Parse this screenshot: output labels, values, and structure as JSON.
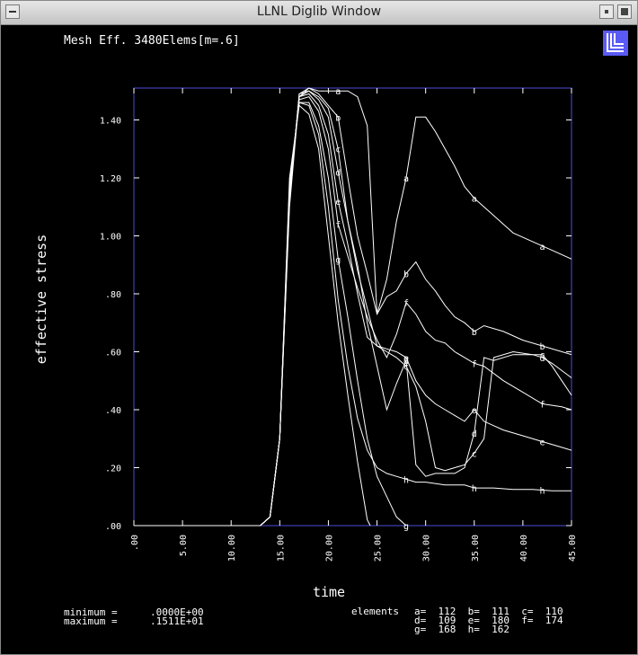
{
  "window": {
    "title": "LLNL Diglib Window"
  },
  "colors": {
    "background": "#000000",
    "frame": "#4b4bd6",
    "curve": "#ffffff",
    "logo": "#5a5af5"
  },
  "icons": {
    "logo": "llnl-logo-icon",
    "menu": "window-menu-icon",
    "minimize": "minimize-icon",
    "maximize": "maximize-icon"
  },
  "footer": {
    "minimum_label": "minimum =",
    "minimum_value": ".0000E+00",
    "maximum_label": "maximum =",
    "maximum_value": ".1511E+01",
    "elements_title": "elements",
    "elements_rows": [
      "a=  112  b=  111  c=  110",
      "d=  109  e=  180  f=  174",
      "g=  168  h=  162"
    ]
  },
  "chart_data": {
    "type": "line",
    "title": "Mesh Eff. 3480Elems[m=.6]",
    "xlabel": "time",
    "ylabel": "effective stress",
    "xlim": [
      0,
      45
    ],
    "ylim": [
      0,
      1.51
    ],
    "x_ticks": [
      0,
      5,
      10,
      15,
      20,
      25,
      30,
      35,
      40,
      45
    ],
    "x_tick_labels": [
      ".00",
      "5.00",
      "10.00",
      "15.00",
      "20.00",
      "25.00",
      "30.00",
      "35.00",
      "40.00",
      "45.00"
    ],
    "y_ticks": [
      0,
      0.2,
      0.4,
      0.6,
      0.8,
      1.0,
      1.2,
      1.4
    ],
    "y_tick_labels": [
      ".00",
      ".20",
      ".40",
      ".60",
      ".80",
      "1.00",
      "1.20",
      "1.40"
    ],
    "grid": false,
    "series": [
      {
        "name": "a",
        "marker_x": [
          21,
          28,
          35,
          42
        ],
        "x": [
          0,
          13,
          14,
          15,
          16,
          17,
          18,
          19,
          20,
          21,
          22,
          23,
          24,
          25,
          26,
          27,
          28,
          29,
          30,
          31,
          32,
          33,
          34,
          35,
          37,
          39,
          41,
          43,
          45
        ],
        "y": [
          0,
          0,
          0.03,
          0.3,
          1.1,
          1.48,
          1.51,
          1.5,
          1.5,
          1.5,
          1.5,
          1.48,
          1.38,
          0.73,
          0.85,
          1.05,
          1.2,
          1.41,
          1.41,
          1.36,
          1.3,
          1.24,
          1.17,
          1.13,
          1.07,
          1.01,
          0.98,
          0.95,
          0.92
        ]
      },
      {
        "name": "b",
        "marker_x": [
          21,
          28,
          35,
          42
        ],
        "x": [
          0,
          13,
          14,
          15,
          16,
          17,
          18,
          19,
          20,
          21,
          22,
          23,
          24,
          25,
          26,
          27,
          28,
          29,
          30,
          31,
          32,
          33,
          34,
          35,
          36,
          38,
          40,
          42,
          45
        ],
        "y": [
          0,
          0,
          0.03,
          0.3,
          1.12,
          1.49,
          1.51,
          1.49,
          1.45,
          1.41,
          1.2,
          1.0,
          0.87,
          0.73,
          0.79,
          0.81,
          0.87,
          0.91,
          0.85,
          0.81,
          0.76,
          0.72,
          0.7,
          0.67,
          0.69,
          0.67,
          0.64,
          0.62,
          0.59
        ]
      },
      {
        "name": "c",
        "marker_x": [
          21,
          28,
          35,
          42
        ],
        "x": [
          0,
          13,
          14,
          15,
          16,
          17,
          18,
          19,
          20,
          21,
          22,
          23,
          24,
          25,
          26,
          27,
          28,
          29,
          30,
          31,
          32,
          33,
          34,
          35,
          36,
          37,
          39,
          41,
          42,
          43,
          44,
          45
        ],
        "y": [
          0,
          0,
          0.03,
          0.3,
          1.13,
          1.49,
          1.5,
          1.48,
          1.44,
          1.3,
          1.05,
          0.88,
          0.75,
          0.62,
          0.6,
          0.58,
          0.55,
          0.48,
          0.36,
          0.2,
          0.19,
          0.2,
          0.21,
          0.25,
          0.3,
          0.58,
          0.6,
          0.59,
          0.59,
          0.55,
          0.5,
          0.45
        ]
      },
      {
        "name": "d",
        "marker_x": [
          21,
          28,
          35,
          42
        ],
        "x": [
          0,
          13,
          14,
          15,
          16,
          17,
          18,
          19,
          20,
          21,
          22,
          23,
          24,
          25,
          26,
          27,
          28,
          29,
          30,
          31,
          32,
          33,
          34,
          35,
          36,
          37,
          39,
          41,
          42,
          43,
          45
        ],
        "y": [
          0,
          0,
          0.03,
          0.3,
          1.14,
          1.48,
          1.5,
          1.47,
          1.41,
          1.22,
          1.05,
          0.9,
          0.7,
          0.55,
          0.4,
          0.49,
          0.57,
          0.21,
          0.17,
          0.18,
          0.18,
          0.18,
          0.2,
          0.32,
          0.58,
          0.57,
          0.59,
          0.59,
          0.58,
          0.56,
          0.51
        ]
      },
      {
        "name": "e",
        "marker_x": [
          21,
          28,
          35,
          42
        ],
        "x": [
          0,
          13,
          14,
          15,
          16,
          17,
          18,
          19,
          20,
          21,
          22,
          23,
          24,
          25,
          26,
          27,
          28,
          29,
          30,
          31,
          32,
          33,
          34,
          35,
          36,
          38,
          40,
          42,
          44,
          45
        ],
        "y": [
          0,
          0,
          0.03,
          0.3,
          1.15,
          1.48,
          1.49,
          1.45,
          1.35,
          1.12,
          0.97,
          0.8,
          0.65,
          0.62,
          0.61,
          0.6,
          0.58,
          0.5,
          0.45,
          0.42,
          0.4,
          0.38,
          0.36,
          0.4,
          0.36,
          0.33,
          0.31,
          0.29,
          0.27,
          0.26
        ]
      },
      {
        "name": "f",
        "marker_x": [
          21,
          28,
          35,
          42
        ],
        "x": [
          0,
          13,
          14,
          15,
          16,
          17,
          18,
          19,
          20,
          21,
          22,
          23,
          24,
          25,
          26,
          27,
          28,
          29,
          30,
          31,
          32,
          33,
          34,
          35,
          36,
          38,
          40,
          42,
          44,
          45
        ],
        "y": [
          0,
          0,
          0.03,
          0.3,
          1.16,
          1.47,
          1.48,
          1.43,
          1.3,
          1.04,
          0.93,
          0.82,
          0.72,
          0.64,
          0.58,
          0.66,
          0.77,
          0.73,
          0.67,
          0.64,
          0.63,
          0.6,
          0.58,
          0.56,
          0.55,
          0.5,
          0.46,
          0.42,
          0.41,
          0.4
        ]
      },
      {
        "name": "g",
        "marker_x": [
          21,
          28
        ],
        "x": [
          0,
          13,
          14,
          15,
          16,
          17,
          18,
          19,
          20,
          21,
          22,
          23,
          24,
          25,
          26,
          27,
          28
        ],
        "y": [
          0,
          0,
          0.03,
          0.3,
          1.17,
          1.46,
          1.46,
          1.38,
          1.2,
          0.92,
          0.72,
          0.5,
          0.3,
          0.17,
          0.1,
          0.03,
          0
        ]
      },
      {
        "name": "h",
        "marker_x": [
          28,
          35,
          42
        ],
        "x": [
          0,
          13,
          14,
          15,
          16,
          17,
          18,
          19,
          20,
          21,
          22,
          23,
          24,
          25,
          26,
          27,
          28,
          29,
          30,
          32,
          34,
          35,
          37,
          39,
          41,
          43,
          45
        ],
        "y": [
          0,
          0,
          0.03,
          0.3,
          1.18,
          1.46,
          1.45,
          1.35,
          1.1,
          0.78,
          0.55,
          0.37,
          0.26,
          0.2,
          0.18,
          0.17,
          0.16,
          0.15,
          0.15,
          0.14,
          0.14,
          0.13,
          0.13,
          0.125,
          0.125,
          0.12,
          0.12
        ]
      },
      {
        "name": "",
        "marker_x": [],
        "x": [
          0,
          13,
          14,
          15,
          16,
          17,
          18,
          19,
          20,
          21,
          22,
          23,
          24,
          24.3
        ],
        "y": [
          0,
          0,
          0.03,
          0.3,
          1.2,
          1.45,
          1.42,
          1.3,
          1.0,
          0.7,
          0.45,
          0.22,
          0.02,
          0
        ]
      }
    ]
  }
}
